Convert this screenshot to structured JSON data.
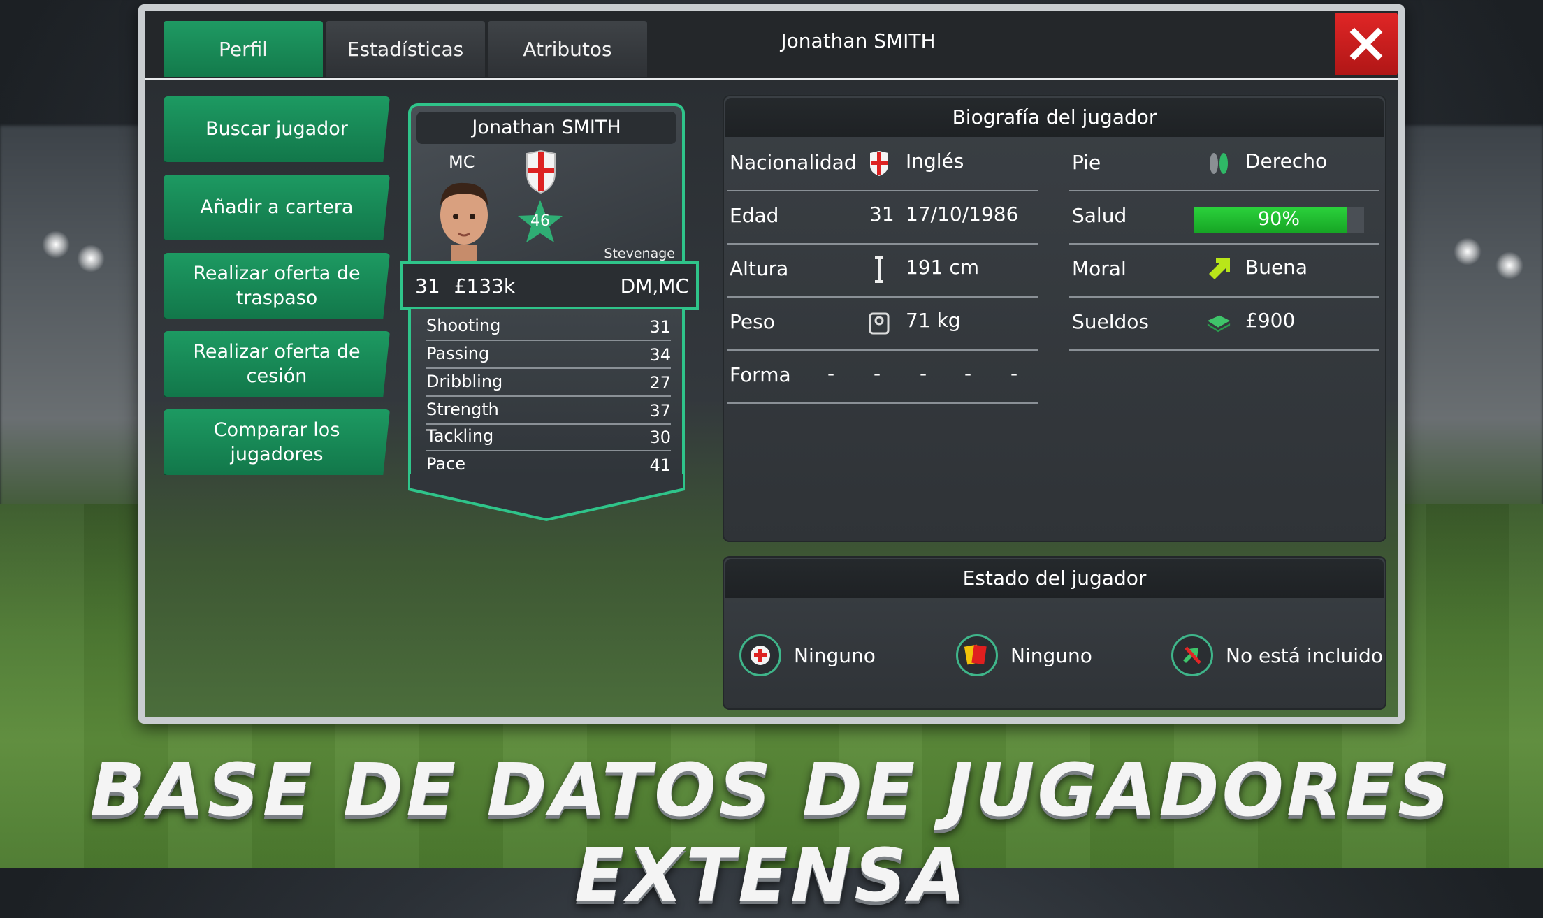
{
  "window": {
    "title": "Jonathan SMITH",
    "tabs": [
      {
        "label": "Perfil",
        "active": true
      },
      {
        "label": "Estadísticas",
        "active": false
      },
      {
        "label": "Atributos",
        "active": false
      }
    ]
  },
  "actions": [
    {
      "label": "Buscar jugador"
    },
    {
      "label": "Añadir a cartera"
    },
    {
      "label": "Realizar oferta de traspaso"
    },
    {
      "label": "Realizar oferta de cesión"
    },
    {
      "label": "Comparar los jugadores"
    }
  ],
  "card": {
    "name": "Jonathan SMITH",
    "position": "MC",
    "rating": "46",
    "club": "Stevenage",
    "age": "31",
    "value": "£133k",
    "positions": "DM,MC",
    "stats": [
      {
        "label": "Shooting",
        "value": "31"
      },
      {
        "label": "Passing",
        "value": "34"
      },
      {
        "label": "Dribbling",
        "value": "27"
      },
      {
        "label": "Strength",
        "value": "37"
      },
      {
        "label": "Tackling",
        "value": "30"
      },
      {
        "label": "Pace",
        "value": "41"
      }
    ]
  },
  "bio": {
    "title": "Biografía del jugador",
    "left": [
      {
        "label": "Nacionalidad",
        "icon": "england-flag-icon",
        "value": "Inglés"
      },
      {
        "label": "Edad",
        "prefix": "31",
        "value": "17/10/1986"
      },
      {
        "label": "Altura",
        "icon": "height-icon",
        "value": "191 cm"
      },
      {
        "label": "Peso",
        "icon": "weight-icon",
        "value": "71 kg"
      },
      {
        "label": "Forma",
        "form": [
          "-",
          "-",
          "-",
          "-",
          "-"
        ]
      }
    ],
    "right": [
      {
        "label": "Pie",
        "icon": "foot-icon",
        "value": "Derecho"
      },
      {
        "label": "Salud",
        "health_percent": 90,
        "value": "90%"
      },
      {
        "label": "Moral",
        "icon": "morale-arrow-icon",
        "value": "Buena"
      },
      {
        "label": "Sueldos",
        "icon": "money-icon",
        "value": "£900"
      }
    ]
  },
  "status": {
    "title": "Estado del jugador",
    "items": [
      {
        "icon": "injury-icon",
        "label": "Ninguno"
      },
      {
        "icon": "card-icon",
        "label": "Ninguno"
      },
      {
        "icon": "transfer-list-icon",
        "label": "No está incluido"
      }
    ]
  },
  "banner": "BASE DE DATOS DE JUGADORES EXTENSA",
  "colors": {
    "accent_green": "#1d9a62",
    "card_border": "#2fc48a",
    "close_red": "#d61f1f",
    "health_green": "#22c334"
  }
}
